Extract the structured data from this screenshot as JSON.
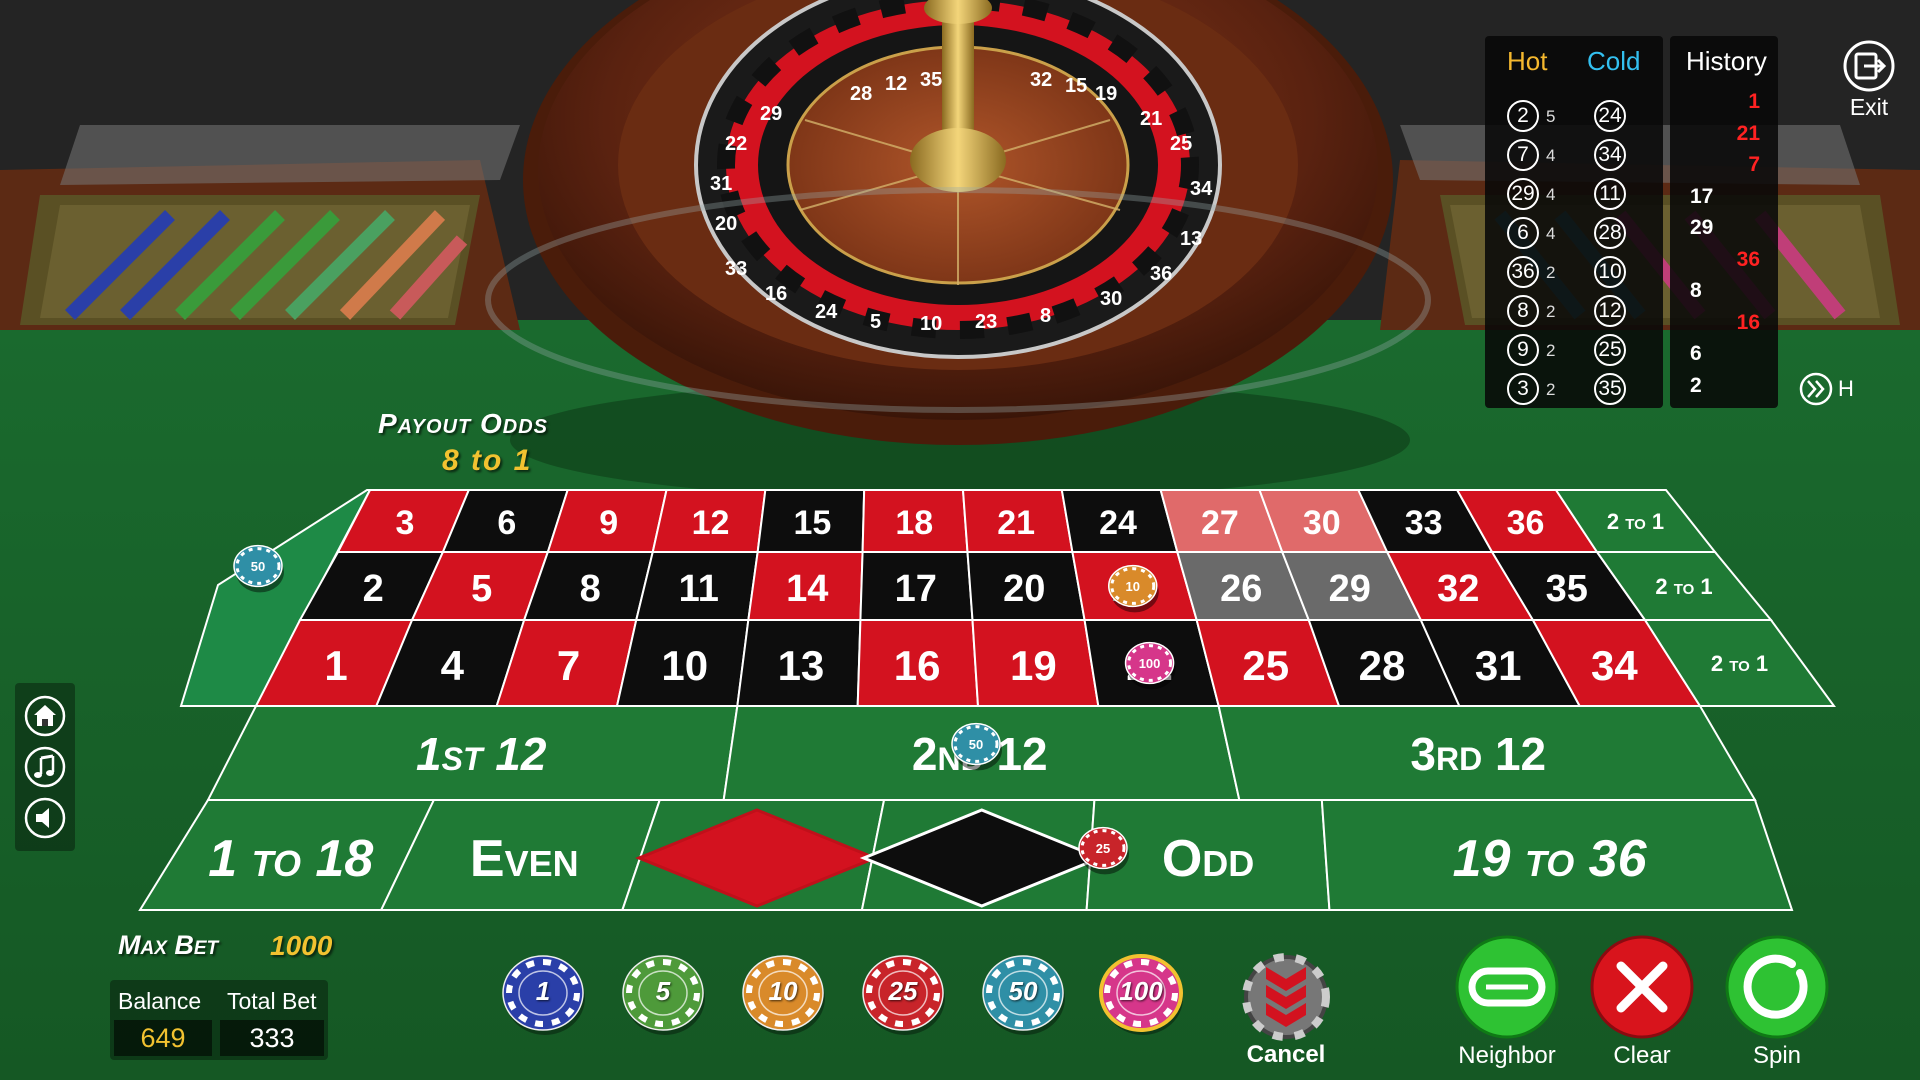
{
  "hot_cold": {
    "hot_header": "Hot",
    "cold_header": "Cold",
    "hot": [
      {
        "number": "2",
        "count": "5",
        "color": "black"
      },
      {
        "number": "7",
        "count": "4",
        "color": "red"
      },
      {
        "number": "29",
        "count": "4",
        "color": "black"
      },
      {
        "number": "6",
        "count": "4",
        "color": "black"
      },
      {
        "number": "36",
        "count": "2",
        "color": "red"
      },
      {
        "number": "8",
        "count": "2",
        "color": "black"
      },
      {
        "number": "9",
        "count": "2",
        "color": "red"
      },
      {
        "number": "3",
        "count": "2",
        "color": "red"
      }
    ],
    "cold": [
      {
        "number": "24",
        "color": "black"
      },
      {
        "number": "34",
        "color": "red"
      },
      {
        "number": "11",
        "color": "black"
      },
      {
        "number": "28",
        "color": "black"
      },
      {
        "number": "10",
        "color": "black"
      },
      {
        "number": "12",
        "color": "red"
      },
      {
        "number": "25",
        "color": "red"
      },
      {
        "number": "35",
        "color": "black"
      }
    ]
  },
  "history": {
    "header": "History",
    "results": [
      {
        "number": "1",
        "color": "red"
      },
      {
        "number": "21",
        "color": "red"
      },
      {
        "number": "7",
        "color": "red"
      },
      {
        "number": "17",
        "color": "black"
      },
      {
        "number": "29",
        "color": "black"
      },
      {
        "number": "36",
        "color": "red"
      },
      {
        "number": "8",
        "color": "black"
      },
      {
        "number": "16",
        "color": "red"
      },
      {
        "number": "6",
        "color": "black"
      },
      {
        "number": "2",
        "color": "black"
      }
    ]
  },
  "exit": {
    "label": "Exit",
    "icon": "exit-icon"
  },
  "history_toggle": {
    "label": "H",
    "icon": "double-chevron-right-icon"
  },
  "side_controls": [
    {
      "name": "home",
      "icon": "home-icon"
    },
    {
      "name": "music",
      "icon": "music-note-icon"
    },
    {
      "name": "sound",
      "icon": "speaker-icon"
    }
  ],
  "payout": {
    "title": "Payout Odds",
    "value": "8 to 1"
  },
  "table": {
    "zero": "0",
    "highlighted_numbers": [
      "27",
      "30",
      "26",
      "29"
    ],
    "rows": [
      [
        {
          "n": "3",
          "c": "red"
        },
        {
          "n": "6",
          "c": "black"
        },
        {
          "n": "9",
          "c": "red"
        },
        {
          "n": "12",
          "c": "red"
        },
        {
          "n": "15",
          "c": "black"
        },
        {
          "n": "18",
          "c": "red"
        },
        {
          "n": "21",
          "c": "red"
        },
        {
          "n": "24",
          "c": "black"
        },
        {
          "n": "27",
          "c": "red"
        },
        {
          "n": "30",
          "c": "red"
        },
        {
          "n": "33",
          "c": "black"
        },
        {
          "n": "36",
          "c": "red"
        }
      ],
      [
        {
          "n": "2",
          "c": "black"
        },
        {
          "n": "5",
          "c": "red"
        },
        {
          "n": "8",
          "c": "black"
        },
        {
          "n": "11",
          "c": "black"
        },
        {
          "n": "14",
          "c": "red"
        },
        {
          "n": "17",
          "c": "black"
        },
        {
          "n": "20",
          "c": "black"
        },
        {
          "n": "23",
          "c": "red"
        },
        {
          "n": "26",
          "c": "black"
        },
        {
          "n": "29",
          "c": "black"
        },
        {
          "n": "32",
          "c": "red"
        },
        {
          "n": "35",
          "c": "black"
        }
      ],
      [
        {
          "n": "1",
          "c": "red"
        },
        {
          "n": "4",
          "c": "black"
        },
        {
          "n": "7",
          "c": "red"
        },
        {
          "n": "10",
          "c": "black"
        },
        {
          "n": "13",
          "c": "black"
        },
        {
          "n": "16",
          "c": "red"
        },
        {
          "n": "19",
          "c": "red"
        },
        {
          "n": "22",
          "c": "black"
        },
        {
          "n": "25",
          "c": "red"
        },
        {
          "n": "28",
          "c": "black"
        },
        {
          "n": "31",
          "c": "black"
        },
        {
          "n": "34",
          "c": "red"
        }
      ]
    ],
    "column_bets": [
      "2 to 1",
      "2 to 1",
      "2 to 1"
    ],
    "dozens": [
      "1st 12",
      "2nd 12",
      "3rd 12"
    ],
    "outside": [
      "1 to 18",
      "Even",
      "red-diamond",
      "black-diamond",
      "Odd",
      "19 to 36"
    ]
  },
  "placed_chips": [
    {
      "bet": "zero",
      "value": "50"
    },
    {
      "bet": "23",
      "value": "10"
    },
    {
      "bet": "22",
      "value": "100"
    },
    {
      "bet": "2nd 12",
      "value": "50"
    },
    {
      "bet": "black",
      "value": "25"
    }
  ],
  "max_bet": {
    "label": "Max Bet",
    "value": "1000"
  },
  "stats": {
    "balance_label": "Balance",
    "balance": "649",
    "total_bet_label": "Total Bet",
    "total_bet": "333"
  },
  "chips": [
    {
      "value": "1",
      "color": "#2a3fa8"
    },
    {
      "value": "5",
      "color": "#4e9a3a"
    },
    {
      "value": "10",
      "color": "#d98a2a"
    },
    {
      "value": "25",
      "color": "#c8242a"
    },
    {
      "value": "50",
      "color": "#2f8fa6"
    },
    {
      "value": "100",
      "color": "#d6368a"
    }
  ],
  "actions": {
    "cancel": "Cancel",
    "neighbor": "Neighbor",
    "clear": "Clear",
    "spin": "Spin"
  },
  "colors": {
    "felt": "#1f7a35",
    "red": "#d3121f",
    "black": "#0d0d0d",
    "gold": "#f2c230",
    "green_button": "#2ec233",
    "red_button": "#d8141c"
  }
}
